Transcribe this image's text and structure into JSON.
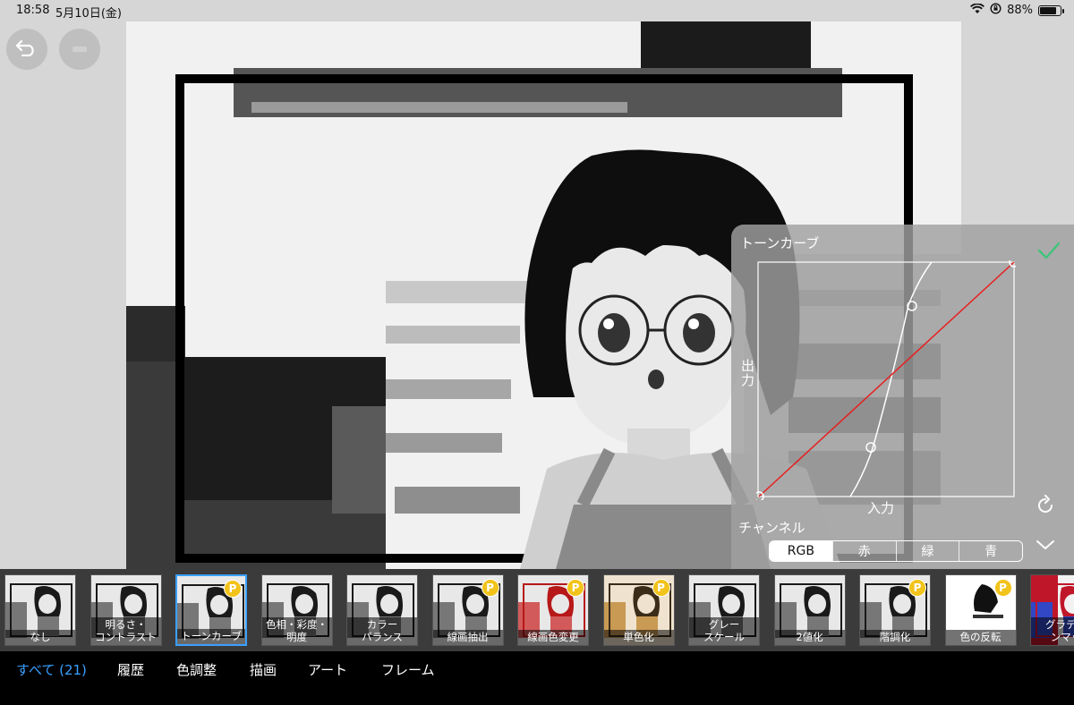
{
  "status_bar": {
    "time": "18:58",
    "date": "5月10日(金)",
    "battery_percent_label": "88%",
    "battery_level": 0.88
  },
  "toolbar": {
    "undo_icon": "undo-arrow-icon",
    "redo_icon": "redo-icon"
  },
  "tone_curve_panel": {
    "title": "トーンカーブ",
    "y_axis_label": "出力",
    "x_axis_label": "入力",
    "channel_label": "チャンネル",
    "channels": [
      "RGB",
      "赤",
      "緑",
      "青"
    ],
    "selected_channel": "RGB",
    "confirm_icon": "checkmark-icon",
    "reset_icon": "reset-icon",
    "collapse_icon": "chevron-down-icon",
    "line_color": "#e81e1e"
  },
  "filters": [
    {
      "label": "なし",
      "premium": false,
      "tint": "none"
    },
    {
      "label": "明るさ・\nコントラスト",
      "premium": false,
      "tint": "none"
    },
    {
      "label": "トーンカーブ",
      "premium": true,
      "tint": "none",
      "selected": true
    },
    {
      "label": "色相・彩度・\n明度",
      "premium": false,
      "tint": "none"
    },
    {
      "label": "カラー\nバランス",
      "premium": false,
      "tint": "none"
    },
    {
      "label": "線画抽出",
      "premium": true,
      "tint": "none"
    },
    {
      "label": "線画色変更",
      "premium": true,
      "tint": "red"
    },
    {
      "label": "単色化",
      "premium": true,
      "tint": "sepia"
    },
    {
      "label": "グレー\nスケール",
      "premium": false,
      "tint": "none"
    },
    {
      "label": "2値化",
      "premium": false,
      "tint": "none"
    },
    {
      "label": "階調化",
      "premium": true,
      "tint": "none"
    },
    {
      "label": "色の反転",
      "premium": true,
      "tint": "invert"
    },
    {
      "label": "グラデー\nンマッ",
      "premium": false,
      "tint": "gradient"
    }
  ],
  "badge_letter": "P",
  "tabs": [
    {
      "label": "すべて (21)",
      "active": true
    },
    {
      "label": "履歴",
      "active": false
    },
    {
      "label": "色調整",
      "active": false
    },
    {
      "label": "描画",
      "active": false
    },
    {
      "label": "アート",
      "active": false
    },
    {
      "label": "フレーム",
      "active": false
    }
  ],
  "colors": {
    "accent": "#3aa0ff",
    "badge": "#f2c31a"
  }
}
